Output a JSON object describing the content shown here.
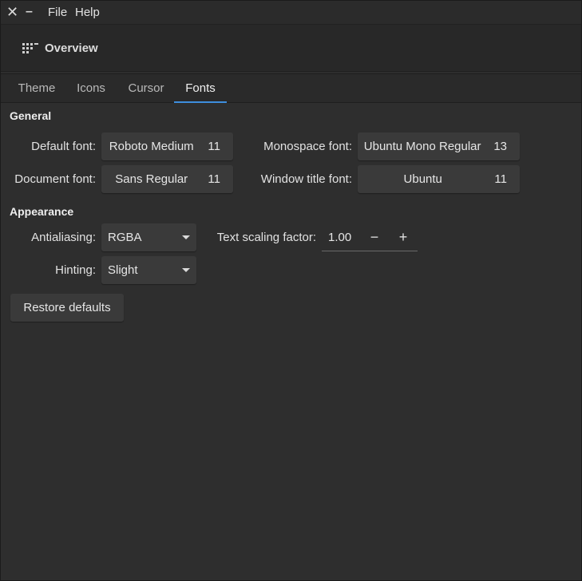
{
  "titlebar": {
    "close_glyph": "✕",
    "minimize_glyph": "–",
    "menu": [
      "File",
      "Help"
    ]
  },
  "header": {
    "overview_label": "Overview",
    "overview_icon": "apps-grid-icon"
  },
  "tabs": [
    {
      "label": "Theme",
      "active": false
    },
    {
      "label": "Icons",
      "active": false
    },
    {
      "label": "Cursor",
      "active": false
    },
    {
      "label": "Fonts",
      "active": true
    }
  ],
  "general": {
    "title": "General",
    "default_font": {
      "label": "Default font:",
      "name": "Roboto Medium",
      "size": "11"
    },
    "monospace_font": {
      "label": "Monospace font:",
      "name": "Ubuntu Mono Regular",
      "size": "13"
    },
    "document_font": {
      "label": "Document font:",
      "name": "Sans Regular",
      "size": "11"
    },
    "window_title_font": {
      "label": "Window title font:",
      "name": "Ubuntu",
      "size": "11"
    }
  },
  "appearance": {
    "title": "Appearance",
    "antialiasing": {
      "label": "Antialiasing:",
      "value": "RGBA"
    },
    "hinting": {
      "label": "Hinting:",
      "value": "Slight"
    },
    "text_scaling": {
      "label": "Text scaling factor:",
      "value": "1.00",
      "minus": "−",
      "plus": "+"
    }
  },
  "restore_defaults_label": "Restore defaults",
  "colors": {
    "background": "#2e2e2e",
    "button": "#3a3a3a",
    "accent": "#3e8ede",
    "text": "#e6e6e6"
  }
}
